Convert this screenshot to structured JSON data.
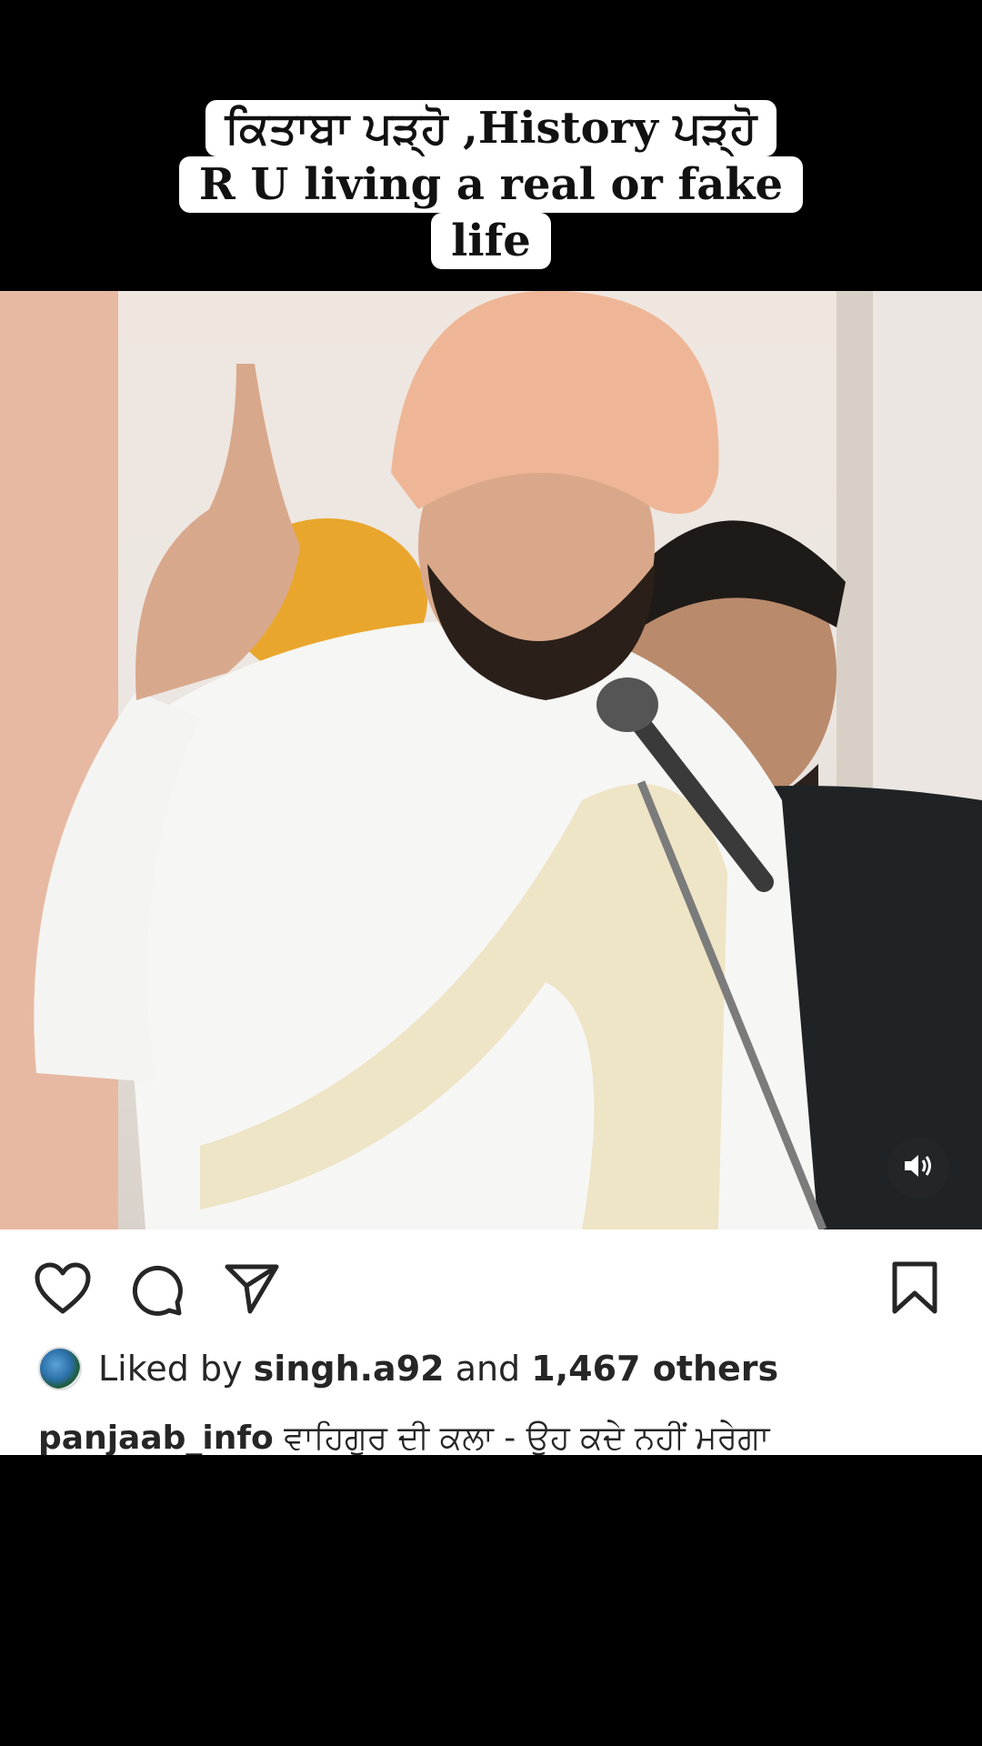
{
  "overlay_caption": {
    "line1": "ਕਿਤਾਬਾ ਪੜ੍ਹੋ ,History ਪੜ੍ਹੋ",
    "line2": "R U living a real or fake",
    "line3": "life"
  },
  "post": {
    "liked_by_prefix": "Liked by",
    "liked_by_user": "singh.a92",
    "and_text": "and",
    "others_count": "1,467 others",
    "author": "panjaab_info",
    "caption_text": "ਵਾਹਿਗੁਰ ਦੀ ਕਲਾ - ਉਹ ਕਦੇ ਨਹੀਂ ਮਰੇਗਾ"
  },
  "icons": {
    "like": "heart-icon",
    "comment": "comment-icon",
    "share": "send-icon",
    "save": "bookmark-icon",
    "sound": "speaker-icon"
  }
}
